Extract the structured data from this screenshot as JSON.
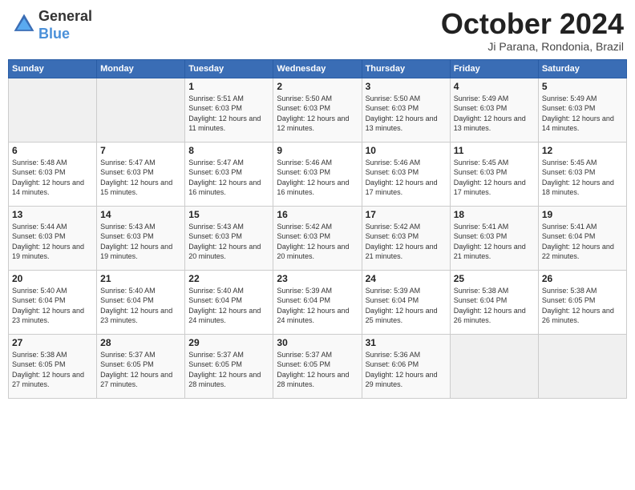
{
  "header": {
    "logo": {
      "line1": "General",
      "line2": "Blue"
    },
    "title": "October 2024",
    "location": "Ji Parana, Rondonia, Brazil"
  },
  "weekdays": [
    "Sunday",
    "Monday",
    "Tuesday",
    "Wednesday",
    "Thursday",
    "Friday",
    "Saturday"
  ],
  "weeks": [
    [
      {
        "day": "",
        "info": ""
      },
      {
        "day": "",
        "info": ""
      },
      {
        "day": "1",
        "info": "Sunrise: 5:51 AM\nSunset: 6:03 PM\nDaylight: 12 hours and 11 minutes."
      },
      {
        "day": "2",
        "info": "Sunrise: 5:50 AM\nSunset: 6:03 PM\nDaylight: 12 hours and 12 minutes."
      },
      {
        "day": "3",
        "info": "Sunrise: 5:50 AM\nSunset: 6:03 PM\nDaylight: 12 hours and 13 minutes."
      },
      {
        "day": "4",
        "info": "Sunrise: 5:49 AM\nSunset: 6:03 PM\nDaylight: 12 hours and 13 minutes."
      },
      {
        "day": "5",
        "info": "Sunrise: 5:49 AM\nSunset: 6:03 PM\nDaylight: 12 hours and 14 minutes."
      }
    ],
    [
      {
        "day": "6",
        "info": "Sunrise: 5:48 AM\nSunset: 6:03 PM\nDaylight: 12 hours and 14 minutes."
      },
      {
        "day": "7",
        "info": "Sunrise: 5:47 AM\nSunset: 6:03 PM\nDaylight: 12 hours and 15 minutes."
      },
      {
        "day": "8",
        "info": "Sunrise: 5:47 AM\nSunset: 6:03 PM\nDaylight: 12 hours and 16 minutes."
      },
      {
        "day": "9",
        "info": "Sunrise: 5:46 AM\nSunset: 6:03 PM\nDaylight: 12 hours and 16 minutes."
      },
      {
        "day": "10",
        "info": "Sunrise: 5:46 AM\nSunset: 6:03 PM\nDaylight: 12 hours and 17 minutes."
      },
      {
        "day": "11",
        "info": "Sunrise: 5:45 AM\nSunset: 6:03 PM\nDaylight: 12 hours and 17 minutes."
      },
      {
        "day": "12",
        "info": "Sunrise: 5:45 AM\nSunset: 6:03 PM\nDaylight: 12 hours and 18 minutes."
      }
    ],
    [
      {
        "day": "13",
        "info": "Sunrise: 5:44 AM\nSunset: 6:03 PM\nDaylight: 12 hours and 19 minutes."
      },
      {
        "day": "14",
        "info": "Sunrise: 5:43 AM\nSunset: 6:03 PM\nDaylight: 12 hours and 19 minutes."
      },
      {
        "day": "15",
        "info": "Sunrise: 5:43 AM\nSunset: 6:03 PM\nDaylight: 12 hours and 20 minutes."
      },
      {
        "day": "16",
        "info": "Sunrise: 5:42 AM\nSunset: 6:03 PM\nDaylight: 12 hours and 20 minutes."
      },
      {
        "day": "17",
        "info": "Sunrise: 5:42 AM\nSunset: 6:03 PM\nDaylight: 12 hours and 21 minutes."
      },
      {
        "day": "18",
        "info": "Sunrise: 5:41 AM\nSunset: 6:03 PM\nDaylight: 12 hours and 21 minutes."
      },
      {
        "day": "19",
        "info": "Sunrise: 5:41 AM\nSunset: 6:04 PM\nDaylight: 12 hours and 22 minutes."
      }
    ],
    [
      {
        "day": "20",
        "info": "Sunrise: 5:40 AM\nSunset: 6:04 PM\nDaylight: 12 hours and 23 minutes."
      },
      {
        "day": "21",
        "info": "Sunrise: 5:40 AM\nSunset: 6:04 PM\nDaylight: 12 hours and 23 minutes."
      },
      {
        "day": "22",
        "info": "Sunrise: 5:40 AM\nSunset: 6:04 PM\nDaylight: 12 hours and 24 minutes."
      },
      {
        "day": "23",
        "info": "Sunrise: 5:39 AM\nSunset: 6:04 PM\nDaylight: 12 hours and 24 minutes."
      },
      {
        "day": "24",
        "info": "Sunrise: 5:39 AM\nSunset: 6:04 PM\nDaylight: 12 hours and 25 minutes."
      },
      {
        "day": "25",
        "info": "Sunrise: 5:38 AM\nSunset: 6:04 PM\nDaylight: 12 hours and 26 minutes."
      },
      {
        "day": "26",
        "info": "Sunrise: 5:38 AM\nSunset: 6:05 PM\nDaylight: 12 hours and 26 minutes."
      }
    ],
    [
      {
        "day": "27",
        "info": "Sunrise: 5:38 AM\nSunset: 6:05 PM\nDaylight: 12 hours and 27 minutes."
      },
      {
        "day": "28",
        "info": "Sunrise: 5:37 AM\nSunset: 6:05 PM\nDaylight: 12 hours and 27 minutes."
      },
      {
        "day": "29",
        "info": "Sunrise: 5:37 AM\nSunset: 6:05 PM\nDaylight: 12 hours and 28 minutes."
      },
      {
        "day": "30",
        "info": "Sunrise: 5:37 AM\nSunset: 6:05 PM\nDaylight: 12 hours and 28 minutes."
      },
      {
        "day": "31",
        "info": "Sunrise: 5:36 AM\nSunset: 6:06 PM\nDaylight: 12 hours and 29 minutes."
      },
      {
        "day": "",
        "info": ""
      },
      {
        "day": "",
        "info": ""
      }
    ]
  ]
}
